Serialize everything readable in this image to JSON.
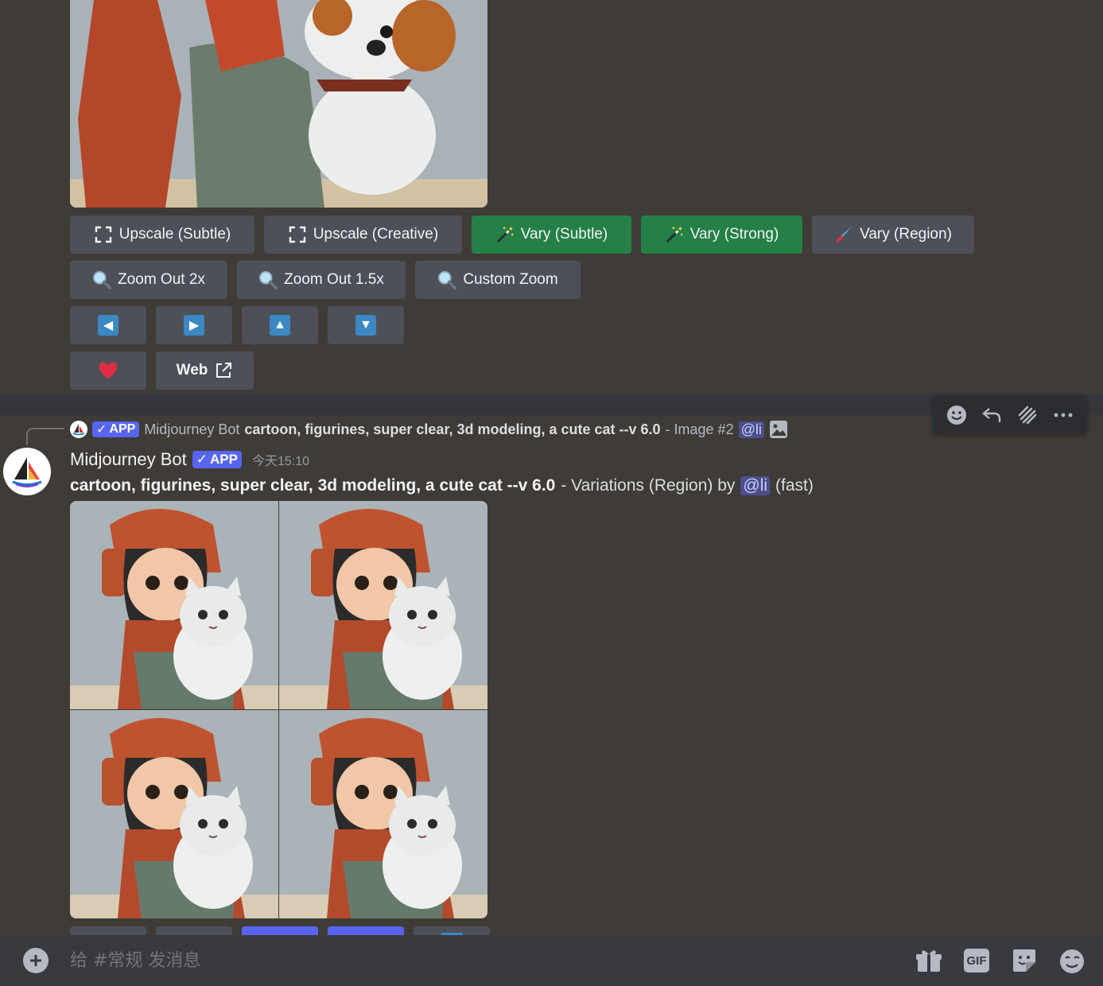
{
  "top_message": {
    "buttons_row1": [
      {
        "label": "Upscale (Subtle)",
        "icon": "upscale-icon",
        "style": "secondary"
      },
      {
        "label": "Upscale (Creative)",
        "icon": "upscale-icon",
        "style": "secondary"
      },
      {
        "label": "Vary (Subtle)",
        "icon": "magic-wand-icon",
        "style": "success"
      },
      {
        "label": "Vary (Strong)",
        "icon": "magic-wand-icon",
        "style": "success"
      },
      {
        "label": "Vary (Region)",
        "icon": "paintbrush-icon",
        "style": "secondary"
      }
    ],
    "buttons_row2": [
      {
        "label": "Zoom Out 2x",
        "icon": "magnifier-icon"
      },
      {
        "label": "Zoom Out 1.5x",
        "icon": "magnifier-icon"
      },
      {
        "label": "Custom Zoom",
        "icon": "magnifier-icon"
      }
    ],
    "pan_buttons": [
      {
        "icon": "arrow-left-icon",
        "glyph": "◀"
      },
      {
        "icon": "arrow-right-icon",
        "glyph": "▶"
      },
      {
        "icon": "arrow-up-icon",
        "glyph": "▲"
      },
      {
        "icon": "arrow-down-icon",
        "glyph": "▼"
      }
    ],
    "favorite_icon": "heart-icon",
    "web_label": "Web"
  },
  "hover_toolbar": [
    "add-reaction-icon",
    "reply-icon",
    "create-thread-icon",
    "more-options-icon"
  ],
  "reply_preview": {
    "badge": "APP",
    "author": "Midjourney Bot",
    "prompt": "cartoon, figurines, super clear, 3d modeling, a cute cat --v 6.0",
    "suffix": "- Image #2",
    "mention": "@li"
  },
  "message": {
    "author": "Midjourney Bot",
    "badge": "APP",
    "timestamp": "今天15:10",
    "prompt": "cartoon, figurines, super clear, 3d modeling, a cute cat --v 6.0",
    "middle": "- Variations (Region) by",
    "mention": "@li",
    "speed": "(fast)"
  },
  "composer": {
    "placeholder": "给 #常规 发消息",
    "gif_label": "GIF"
  },
  "colors": {
    "background": "#3f3b37",
    "button_secondary": "#4e5058",
    "button_success": "#248046",
    "blurple": "#5865f2",
    "composer": "#383a40"
  }
}
